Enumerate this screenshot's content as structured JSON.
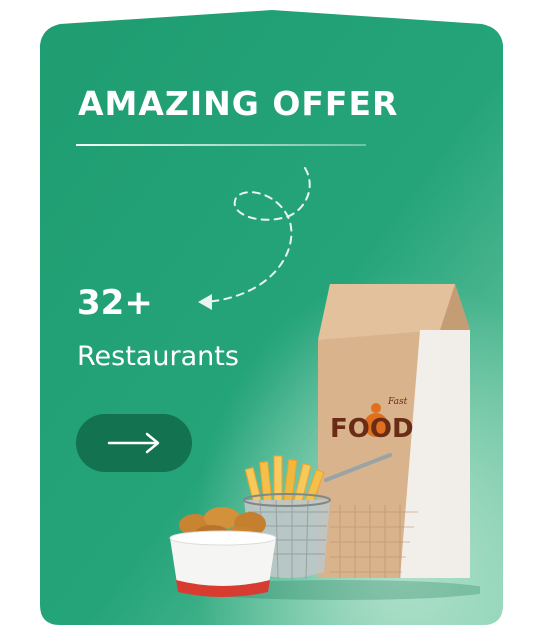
{
  "offer": {
    "title": "AMAZING OFFER",
    "count": "32+",
    "label": "Restaurants"
  },
  "bag": {
    "brand_text": "FOOD",
    "brand_script": "Fast"
  },
  "colors": {
    "card": "#1f9d71",
    "button": "#137250",
    "bag": "#d9b48c",
    "text": "#ffffff"
  },
  "icons": {
    "button_icon": "arrow-right-icon"
  }
}
